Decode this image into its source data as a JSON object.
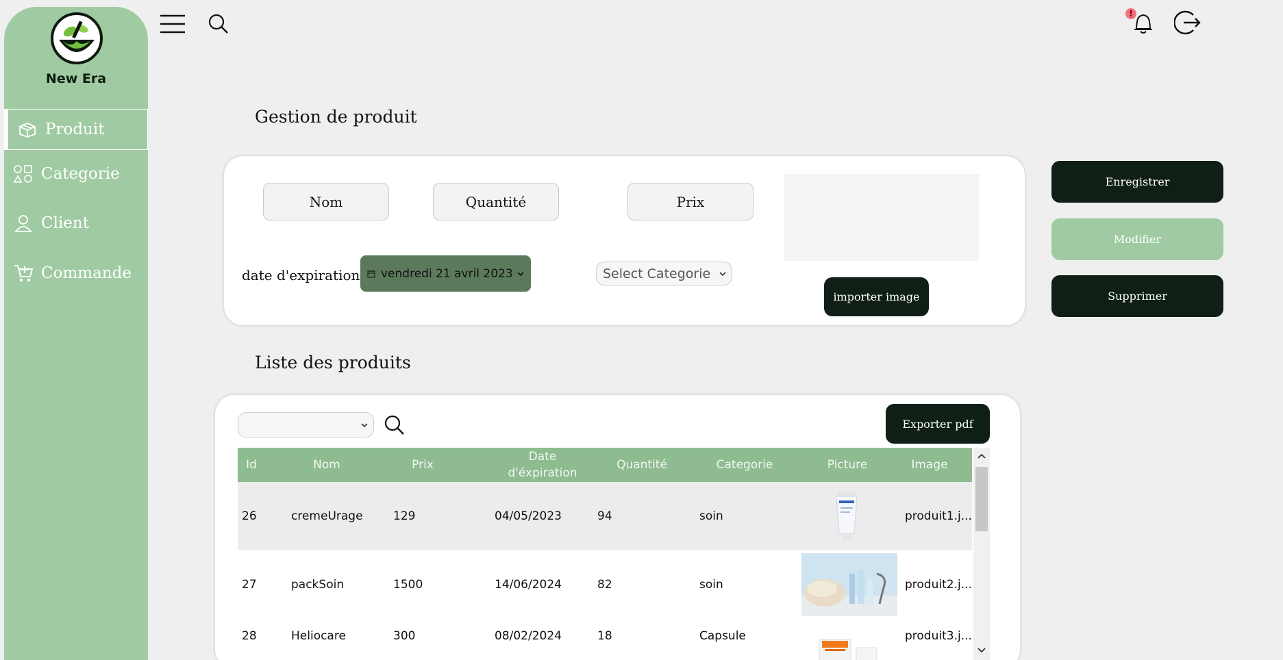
{
  "app": {
    "brand": "New Era"
  },
  "sidebar": {
    "items": [
      {
        "label": "Produit",
        "icon": "box-icon",
        "active": true
      },
      {
        "label": "Categorie",
        "icon": "shapes-icon",
        "active": false
      },
      {
        "label": "Client",
        "icon": "user-icon",
        "active": false
      },
      {
        "label": "Commande",
        "icon": "cart-icon",
        "active": false
      }
    ]
  },
  "topbar": {
    "notification_badge": "!"
  },
  "form": {
    "title": "Gestion de produit",
    "nom_label": "Nom",
    "quantite_label": "Quantité",
    "prix_label": "Prix",
    "date_label": "date d'expiration",
    "date_value": "vendredi 21 avril 2023",
    "category_placeholder": "Select Categorie",
    "import_button": "importer image"
  },
  "actions": {
    "save": "Enregistrer",
    "modify": "Modifier",
    "delete": "Supprimer"
  },
  "list": {
    "title": "Liste des produits",
    "filter_value": "",
    "export_button": "Exporter pdf",
    "columns": [
      "Id",
      "Nom",
      "Prix",
      "Date d'éxpiration",
      "Quantité",
      "Categorie",
      "Picture",
      "Image"
    ],
    "rows": [
      {
        "id": "26",
        "nom": "cremeUrage",
        "prix": "129",
        "date": "04/05/2023",
        "quantite": "94",
        "categorie": "soin",
        "image": "produit1.j..."
      },
      {
        "id": "27",
        "nom": "packSoin",
        "prix": "1500",
        "date": "14/06/2024",
        "quantite": "82",
        "categorie": "soin",
        "image": "produit2.j..."
      },
      {
        "id": "28",
        "nom": "Heliocare",
        "prix": "300",
        "date": "08/02/2024",
        "quantite": "18",
        "categorie": "Capsule",
        "image": "produit3.j..."
      }
    ]
  },
  "colors": {
    "sidebar": "#a0cba2",
    "dark_button": "#101f16",
    "table_header": "#8ebc90",
    "date_picker": "#5b7a5c"
  }
}
